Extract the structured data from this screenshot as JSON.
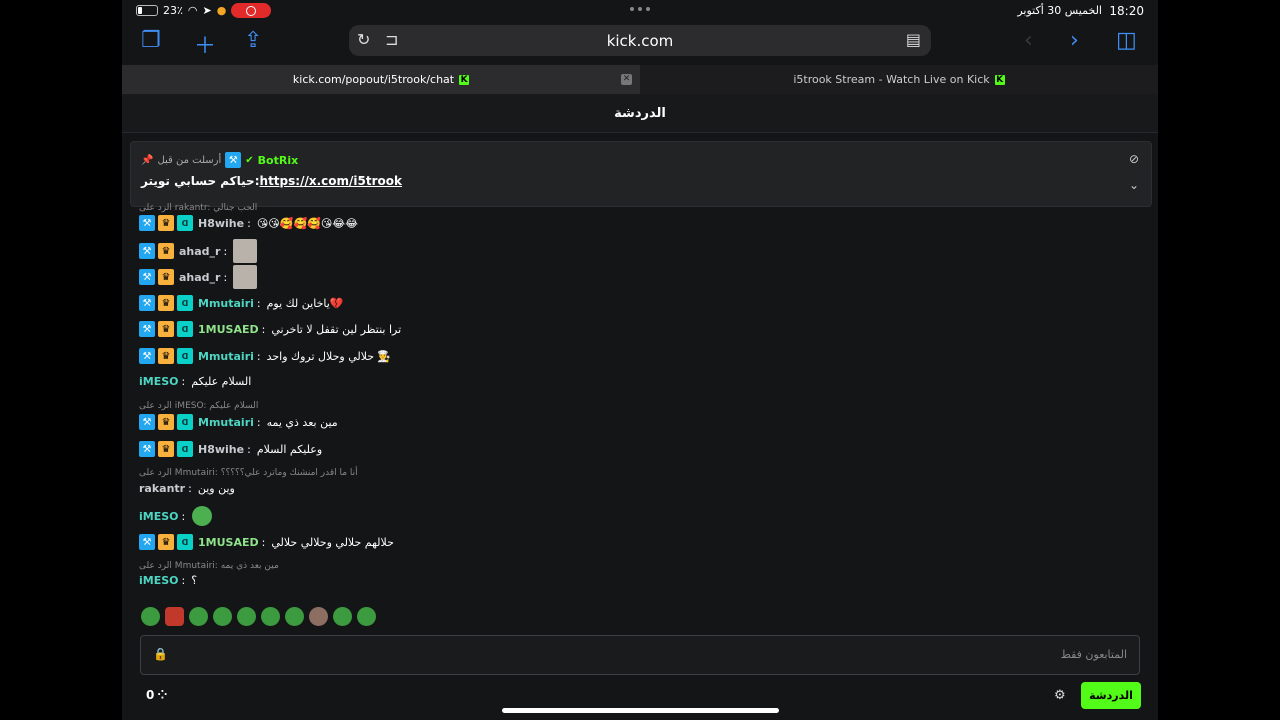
{
  "status": {
    "time": "18:20",
    "date": "الخميس 30 أكتوبر",
    "battery": "23٪"
  },
  "browser": {
    "url": "kick.com"
  },
  "tabs": [
    {
      "label": "kick.com/popout/i5trook/chat",
      "active": true
    },
    {
      "label": "i5trook Stream - Watch Live on Kick",
      "active": false
    }
  ],
  "chat": {
    "title": "الدردشة",
    "pinned": {
      "user": "BotRix",
      "note": "أرسلت من قبل",
      "text": "حياكم حسابي تويتر:",
      "link": "https://x.com/i5trook"
    },
    "reply1": "الرد على rakantr: الحب جنالي",
    "reply2": "الرد على iMESO: السلام عليكم",
    "reply3": "الرد على Mmutairi: أنا ما اقدر امنشنك وماترد علي؟؟؟؟؟",
    "reply4": "الرد على Mmutairi: مين بعد ذي يمه",
    "messages": [
      {
        "user": "H8wihe",
        "text": "😘😘🥰🥰🥰😘😂😂",
        "color": "#c8ccd0"
      },
      {
        "user": "ahad_r",
        "text": "",
        "color": "#c8ccd0"
      },
      {
        "user": "ahad_r",
        "text": "",
        "color": "#c8ccd0"
      },
      {
        "user": "Mmutairi",
        "text": "ياخاين لك يوم💔",
        "color": "#4ed6c3"
      },
      {
        "user": "1MUSAED",
        "text": "ترا بنتظر لين تقفل لا تاخرني",
        "color": "#8fe38a"
      },
      {
        "user": "Mmutairi",
        "text": "حلالي وحلال تروك واحد",
        "color": "#4ed6c3"
      },
      {
        "user": "iMESO",
        "text": "السلام عليكم",
        "color": "#4ed6c3"
      },
      {
        "user": "Mmutairi",
        "text": "مين بعد ذي يمه",
        "color": "#4ed6c3"
      },
      {
        "user": "H8wihe",
        "text": "وعليكم السلام",
        "color": "#c8ccd0"
      },
      {
        "user": "rakantr",
        "text": "وين وين",
        "color": "#c8ccd0"
      },
      {
        "user": "iMESO",
        "text": "",
        "color": "#4ed6c3"
      },
      {
        "user": "1MUSAED",
        "text": "حلالهم حلالي وحلالي حلالي",
        "color": "#8fe38a"
      },
      {
        "user": "iMESO",
        "text": "؟",
        "color": "#4ed6c3"
      }
    ],
    "input_placeholder": "المتابعون فقط",
    "send_label": "الدردشة",
    "viewer_count": "0"
  }
}
